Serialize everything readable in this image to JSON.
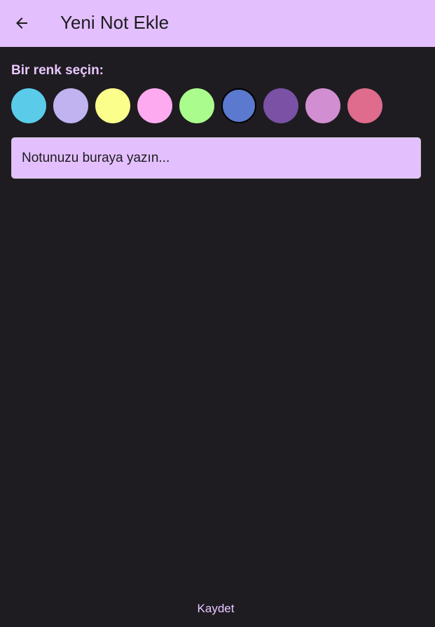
{
  "theme": {
    "app_bar_color": "#e3c0fd",
    "background_color": "#1e1c21",
    "accent_text_color": "#e9c7ff",
    "field_fill_color": "#e3c0fd"
  },
  "app_bar": {
    "back_icon": "arrow-left-icon",
    "title": "Yeni Not Ekle"
  },
  "color_picker": {
    "label": "Bir renk seçin:",
    "selected_index": 5,
    "colors": [
      "#5bcbea",
      "#c0b3f0",
      "#fcfe8b",
      "#fdaaf0",
      "#aafd8d",
      "#5b79ce",
      "#7b51a6",
      "#d18ed1",
      "#df6b8d"
    ]
  },
  "note_field": {
    "placeholder": "Notunuzu buraya yazın...",
    "value": ""
  },
  "save_button": {
    "label": "Kaydet"
  }
}
